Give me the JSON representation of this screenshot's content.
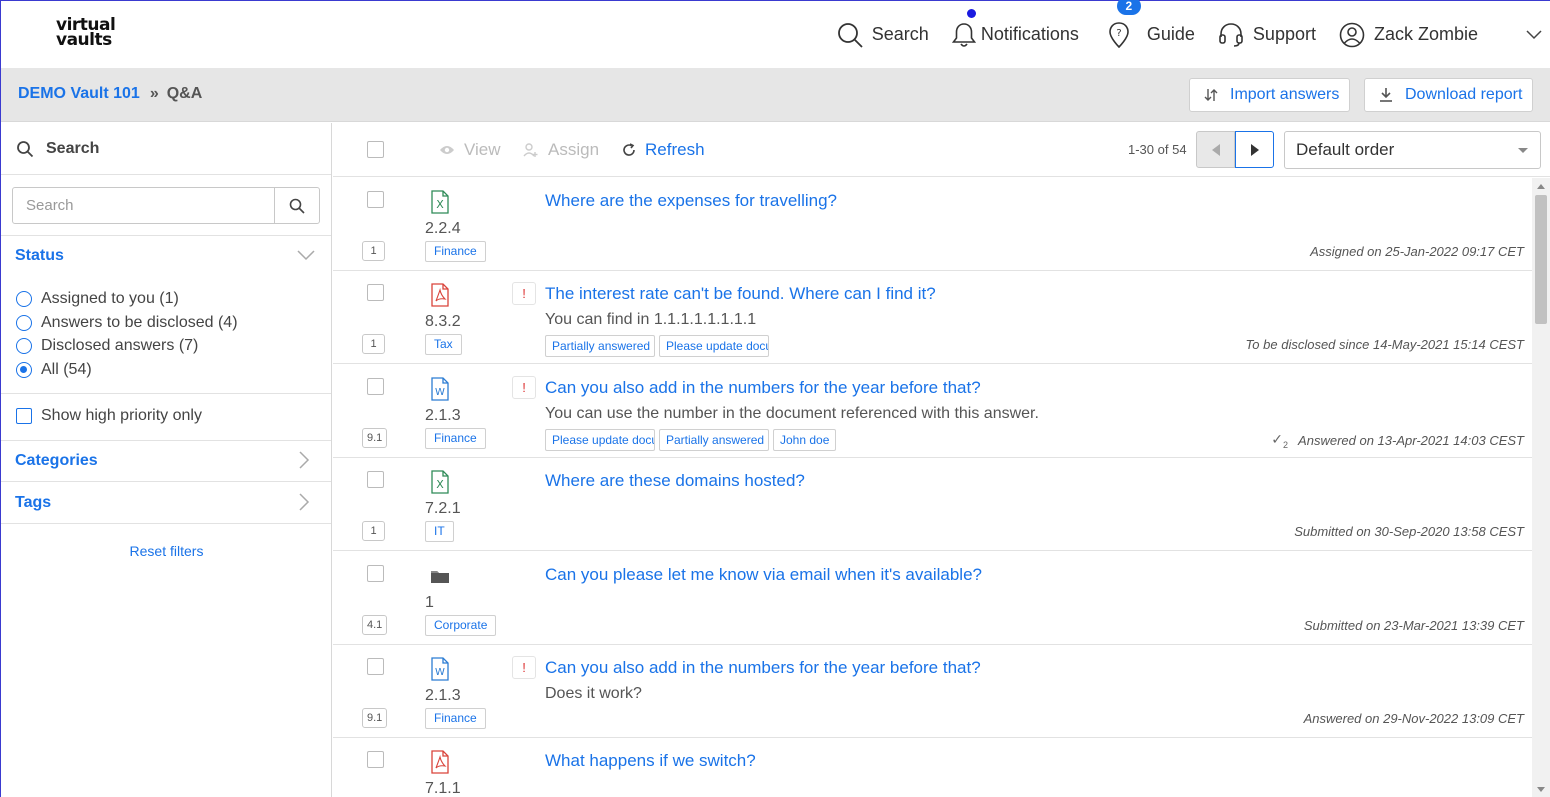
{
  "brand": {
    "line1": "virtual",
    "line2": "vaults"
  },
  "topnav": {
    "search": "Search",
    "notifications": "Notifications",
    "guide": "Guide",
    "guide_badge": "2",
    "support": "Support",
    "user": "Zack Zombie"
  },
  "breadcrumb": {
    "vault": "DEMO Vault 101",
    "separator": "»",
    "page": "Q&A"
  },
  "actions": {
    "import": "Import answers",
    "download": "Download report"
  },
  "sidebar": {
    "search_title": "Search",
    "search_placeholder": "Search",
    "status_title": "Status",
    "status_options": [
      {
        "label": "Assigned to you (1)",
        "checked": false
      },
      {
        "label": "Answers to be disclosed (4)",
        "checked": false
      },
      {
        "label": "Disclosed answers (7)",
        "checked": false
      },
      {
        "label": "All (54)",
        "checked": true
      }
    ],
    "high_priority": "Show high priority only",
    "categories": "Categories",
    "tags": "Tags",
    "reset": "Reset filters"
  },
  "toolbar": {
    "view": "View",
    "assign": "Assign",
    "refresh": "Refresh",
    "pager": "1-30 of 54",
    "order": "Default order"
  },
  "rows": [
    {
      "count": "1",
      "filetype": "excel",
      "ref": "2.2.4",
      "category": "Finance",
      "priority": false,
      "question": "Where are the expenses for travelling?",
      "answer": "",
      "tags": [],
      "status": "Assigned on 25-Jan-2022 09:17 CET",
      "check": ""
    },
    {
      "count": "1",
      "filetype": "pdf",
      "ref": "8.3.2",
      "category": "Tax",
      "priority": true,
      "question": "The interest rate can't be found. Where can I find it?",
      "answer": "You can find in 1.1.1.1.1.1.1.1",
      "tags": [
        "Partially answered",
        "Please update docu"
      ],
      "status": "To be disclosed since 14-May-2021 15:14 CEST",
      "check": ""
    },
    {
      "count": "9.1",
      "filetype": "word",
      "ref": "2.1.3",
      "category": "Finance",
      "priority": true,
      "question": "Can you also add in the numbers for the year before that?",
      "answer": "You can use the number in the document referenced with this answer.",
      "tags": [
        "Please update docu",
        "Partially answered",
        "John doe"
      ],
      "status": "Answered on 13-Apr-2021 14:03 CEST",
      "check": "2"
    },
    {
      "count": "1",
      "filetype": "excel",
      "ref": "7.2.1",
      "category": "IT",
      "priority": false,
      "question": "Where are these domains hosted?",
      "answer": "",
      "tags": [],
      "status": "Submitted on 30-Sep-2020 13:58 CEST",
      "check": ""
    },
    {
      "count": "4.1",
      "filetype": "folder",
      "ref": "1",
      "category": "Corporate",
      "priority": false,
      "question": "Can you please let me know via email when it's available?",
      "answer": "",
      "tags": [],
      "status": "Submitted on 23-Mar-2021 13:39 CET",
      "check": ""
    },
    {
      "count": "9.1",
      "filetype": "word",
      "ref": "2.1.3",
      "category": "Finance",
      "priority": true,
      "question": "Can you also add in the numbers for the year before that?",
      "answer": "Does it work?",
      "tags": [],
      "status": "Answered on 29-Nov-2022 13:09 CET",
      "check": ""
    },
    {
      "count": "",
      "filetype": "pdf",
      "ref": "7.1.1",
      "category": "",
      "priority": false,
      "question": "What happens if we switch?",
      "answer": "",
      "tags": [],
      "status": "",
      "check": ""
    }
  ],
  "colors": {
    "accent": "#1a73e8",
    "excel": "#2e8b57",
    "pdf": "#d9433a",
    "word": "#2b7cd3",
    "folder": "#555555",
    "priority": "#dd3333"
  }
}
